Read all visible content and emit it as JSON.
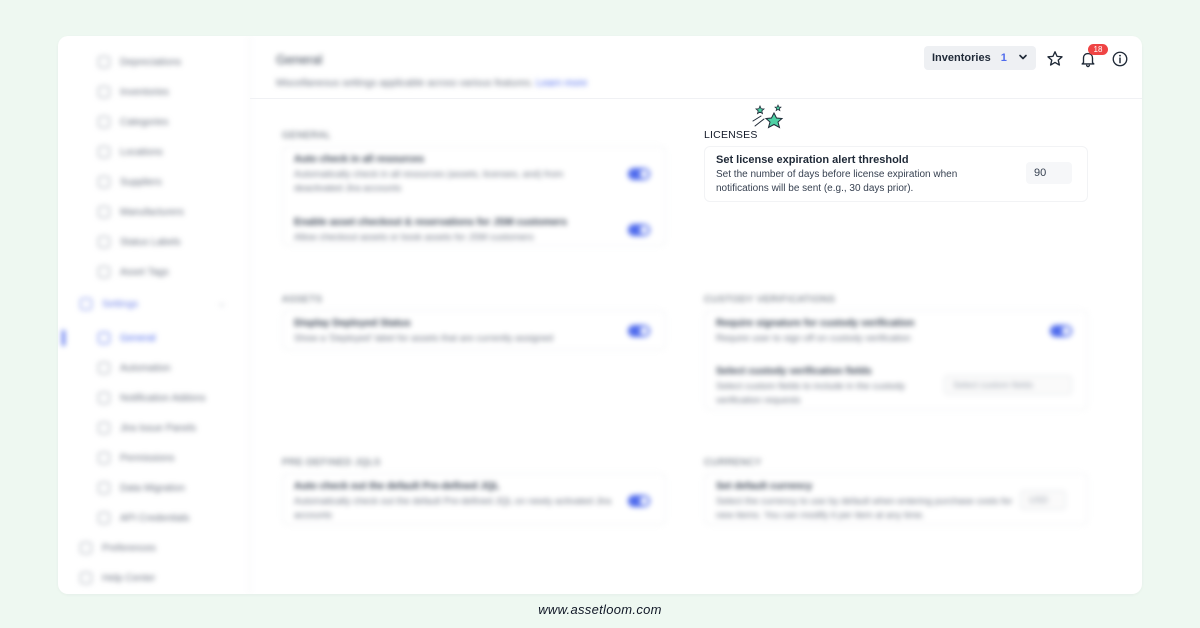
{
  "sidebar": {
    "items": [
      {
        "label": "Depreciations"
      },
      {
        "label": "Inventories"
      },
      {
        "label": "Categories"
      },
      {
        "label": "Locations"
      },
      {
        "label": "Suppliers"
      },
      {
        "label": "Manufacturers"
      },
      {
        "label": "Status Labels"
      },
      {
        "label": "Asset Tags"
      }
    ],
    "settings_label": "Settings",
    "settings_items": [
      {
        "label": "General"
      },
      {
        "label": "Automation"
      },
      {
        "label": "Notification Addons"
      },
      {
        "label": "Jira Issue Panels"
      },
      {
        "label": "Permissions"
      },
      {
        "label": "Data Migration"
      },
      {
        "label": "API Credentials"
      }
    ],
    "preferences_label": "Preferences",
    "help_label": "Help Center"
  },
  "header": {
    "title": "General",
    "subtitle": "Miscellaneous settings applicable across various features.",
    "learn_more": "Learn more",
    "inventory_label": "Inventories",
    "inventory_count": "1",
    "notification_count": "18"
  },
  "sections": {
    "general": {
      "title": "GENERAL",
      "row1_title": "Auto check in all resources",
      "row1_desc": "Automatically check in all resources (assets, licenses, and) from deactivated Jira accounts",
      "row2_title": "Enable asset checkout & reservations for JSM customers",
      "row2_desc": "Allow checkout assets or book assets for JSM customers"
    },
    "assets": {
      "title": "ASSETS",
      "row1_title": "Display Deployed Status",
      "row1_desc": "Show a 'Deployed' label for assets that are currently assigned"
    },
    "predefined": {
      "title": "PRE-DEFINED JQLS",
      "row1_title": "Auto check out the default Pre-defined JQL",
      "row1_desc": "Automatically check out the default Pre-defined JQL on newly activated Jira accounts"
    },
    "licenses": {
      "title": "LICENSES",
      "row_title": "Set license expiration alert threshold",
      "row_desc": "Set the number of days before license expiration when notifications will be sent (e.g., 30 days prior).",
      "value": "90"
    },
    "custody": {
      "title": "CUSTODY VERIFICATIONS",
      "row1_title": "Require signature for custody verification",
      "row1_desc": "Require user to sign off on custody verification",
      "row2_title": "Select custody verification fields",
      "row2_desc": "Select custom fields to include in the custody verification requests",
      "select_placeholder": "Select custom fields"
    },
    "currency": {
      "title": "CURRENCY",
      "row_title": "Set default currency",
      "row_desc": "Select the currency to use by default when entering purchase costs for new items. You can modify it per item at any time.",
      "value": "USD"
    }
  },
  "footer": {
    "url": "www.assetloom.com"
  },
  "colors": {
    "accent": "#4f6bed",
    "background": "#eef8f1",
    "badge": "#ef4444"
  }
}
